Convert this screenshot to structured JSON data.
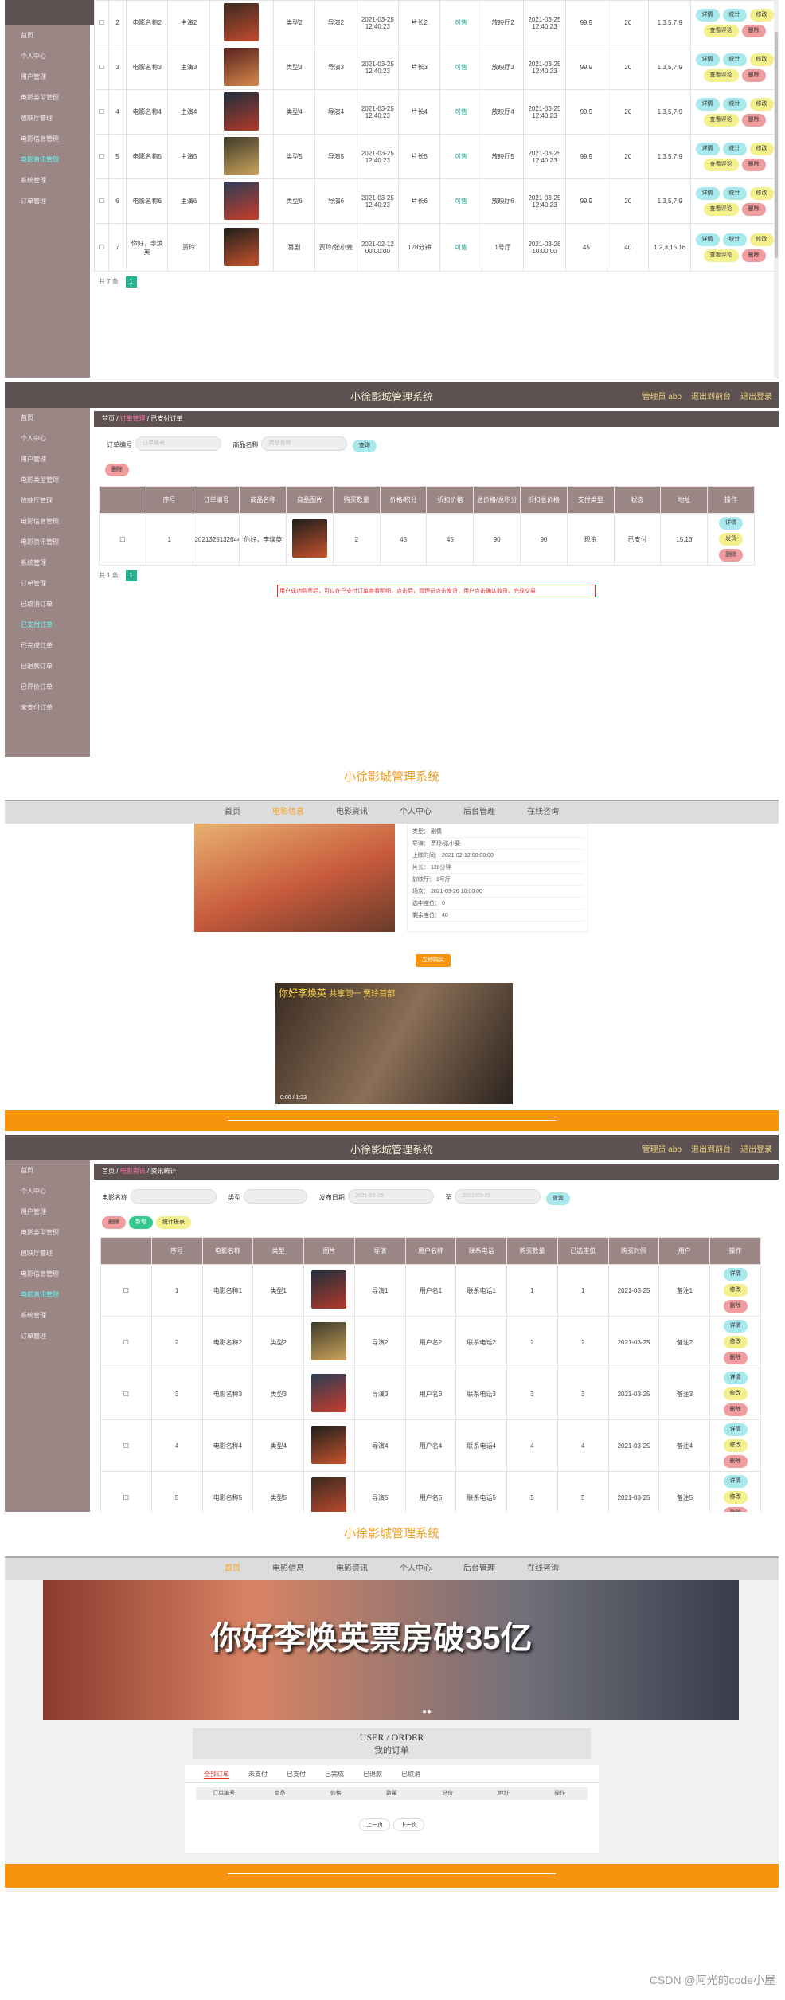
{
  "admin": {
    "title": "小徐影城管理系统",
    "links": [
      "管理员 abo",
      "退出到前台",
      "退出登录"
    ]
  },
  "shot1": {
    "rows": [
      {
        "idx": "2",
        "name": "电影名称2",
        "actor": "主演2",
        "type": "类型2",
        "dir": "导演2",
        "time": "2021-03-25 12:40:23",
        "len": "片长2",
        "stat": "可售",
        "hall": "放映厅2",
        "date": "2021-03-25 12:40:23",
        "price": "99.9",
        "seat": "20",
        "rows": "1,3,5,7,9"
      },
      {
        "idx": "3",
        "name": "电影名称3",
        "actor": "主演3",
        "type": "类型3",
        "dir": "导演3",
        "time": "2021-03-25 12:40:23",
        "len": "片长3",
        "stat": "可售",
        "hall": "放映厅3",
        "date": "2021-03-25 12:40:23",
        "price": "99.9",
        "seat": "20",
        "rows": "1,3,5,7,9"
      },
      {
        "idx": "4",
        "name": "电影名称4",
        "actor": "主演4",
        "type": "类型4",
        "dir": "导演4",
        "time": "2021-03-25 12:40:23",
        "len": "片长4",
        "stat": "可售",
        "hall": "放映厅4",
        "date": "2021-03-25 12:40:23",
        "price": "99.9",
        "seat": "20",
        "rows": "1,3,5,7,9"
      },
      {
        "idx": "5",
        "name": "电影名称5",
        "actor": "主演5",
        "type": "类型5",
        "dir": "导演5",
        "time": "2021-03-25 12:40:23",
        "len": "片长5",
        "stat": "可售",
        "hall": "放映厅5",
        "date": "2021-03-25 12:40:23",
        "price": "99.9",
        "seat": "20",
        "rows": "1,3,5,7,9"
      },
      {
        "idx": "6",
        "name": "电影名称6",
        "actor": "主演6",
        "type": "类型6",
        "dir": "导演6",
        "time": "2021-03-25 12:40:23",
        "len": "片长6",
        "stat": "可售",
        "hall": "放映厅6",
        "date": "2021-03-25 12:40:23",
        "price": "99.9",
        "seat": "20",
        "rows": "1,3,5,7,9"
      },
      {
        "idx": "7",
        "name": "你好，李焕英",
        "actor": "贾玲",
        "type": "喜剧",
        "dir": "贾玲/张小斐",
        "time": "2021-02-12 00:00:00",
        "len": "128分钟",
        "stat": "可售",
        "hall": "1号厅",
        "date": "2021-03-26 10:00:00",
        "price": "45",
        "seat": "40",
        "rows": "1,2,3,15,16"
      }
    ],
    "actions": [
      "详情",
      "统计",
      "修改",
      "查看评论",
      "删除"
    ],
    "pager": "共 7 条"
  },
  "shot2": {
    "sidebar": [
      "首页",
      "个人中心",
      "用户管理",
      "电影类型管理",
      "放映厅管理",
      "电影信息管理",
      "电影资讯管理",
      "系统管理",
      "订单管理",
      "已取消订单",
      "已支付订单",
      "已完成订单",
      "已退款订单",
      "已评价订单",
      "未支付订单"
    ],
    "crumb": [
      "首页",
      "订单管理",
      "已支付订单"
    ],
    "filters": {
      "l1": "订单编号",
      "p1": "订单编号",
      "l2": "商品名称",
      "p2": "商品名称",
      "search": "查询"
    },
    "delete": "删除",
    "headers": [
      "",
      "序号",
      "订单编号",
      "商品名称",
      "商品图片",
      "购买数量",
      "价格/积分",
      "折扣价格",
      "总价格/总积分",
      "折扣总价格",
      "支付类型",
      "状态",
      "地址",
      "操作"
    ],
    "row": {
      "idx": "1",
      "no": "20213251326446893",
      "good": "你好，李焕英",
      "qty": "2",
      "p": "45",
      "dp": "45",
      "tot": "90",
      "dtot": "90",
      "pay": "现金",
      "st": "已支付",
      "addr": "15,16"
    },
    "acts": [
      "详情",
      "发货",
      "删除"
    ],
    "pager": "共 1 条",
    "tip": "用户成功购票后，可以在已支付订单查看明细，点击后，管理员点击发货，用户点击确认收货，完成交易"
  },
  "shot3": {
    "title": "小徐影城管理系统",
    "nav": [
      "首页",
      "电影信息",
      "电影资讯",
      "个人中心",
      "后台管理",
      "在线咨询"
    ],
    "navOn": 1,
    "details": [
      [
        "类型",
        "剧情"
      ],
      [
        "导演",
        "贾玲/张小斐"
      ],
      [
        "上映时间",
        "2021-02-12 00:00:00"
      ],
      [
        "片长",
        "128分钟"
      ],
      [
        "放映厅",
        "1号厅"
      ],
      [
        "场次",
        "2021-03-26 10:00:00"
      ],
      [
        "选中座位",
        "0"
      ],
      [
        "剩余座位",
        "40"
      ]
    ],
    "buy": "立即购买",
    "video": {
      "t1": "你好李焕英",
      "t2": "共享同一 贾玲首部",
      "time": "0:00 / 1:23"
    }
  },
  "shot4": {
    "crumb": [
      "首页",
      "电影资讯",
      "资讯统计"
    ],
    "filters": [
      "电影名称",
      "类型",
      "发布日期",
      "2021-03-25",
      "至",
      "2021-03-29",
      "查询"
    ],
    "btns": [
      "删除",
      "新增",
      "统计报表"
    ],
    "headers": [
      "",
      "序号",
      "电影名称",
      "类型",
      "图片",
      "导演",
      "用户名称",
      "联系电话",
      "购买数量",
      "已选座位",
      "购买时间",
      "用户",
      "操作"
    ],
    "rows": [
      [
        "1",
        "电影名称1",
        "类型1",
        "导演1",
        "用户名1",
        "联系电话1",
        "1",
        "1",
        "2021-03-25",
        "备注1"
      ],
      [
        "2",
        "电影名称2",
        "类型2",
        "导演2",
        "用户名2",
        "联系电话2",
        "2",
        "2",
        "2021-03-25",
        "备注2"
      ],
      [
        "3",
        "电影名称3",
        "类型3",
        "导演3",
        "用户名3",
        "联系电话3",
        "3",
        "3",
        "2021-03-25",
        "备注3"
      ],
      [
        "4",
        "电影名称4",
        "类型4",
        "导演4",
        "用户名4",
        "联系电话4",
        "4",
        "4",
        "2021-03-25",
        "备注4"
      ],
      [
        "5",
        "电影名称5",
        "类型5",
        "导演5",
        "用户名5",
        "联系电话5",
        "5",
        "5",
        "2021-03-25",
        "备注5"
      ]
    ],
    "acts": [
      "详情",
      "修改",
      "删除"
    ]
  },
  "shot5": {
    "title": "小徐影城管理系统",
    "nav": [
      "首页",
      "电影信息",
      "电影资讯",
      "个人中心",
      "后台管理",
      "在线咨询"
    ],
    "banner": "你好李焕英票房破35亿",
    "h1": "USER / ORDER",
    "h2": "我的订单",
    "tabs": [
      "全部订单",
      "未支付",
      "已支付",
      "已完成",
      "已退款",
      "已取消"
    ],
    "cols": [
      "订单编号",
      "商品",
      "价格",
      "数量",
      "总价",
      "地址",
      "操作"
    ],
    "pager": [
      "上一页",
      "下一页"
    ]
  },
  "watermark": "CSDN @阿光的code小屋",
  "colors": {
    "brand": "#5e5152",
    "side": "#9a8684",
    "orange": "#f7930e",
    "accent": "#24b38e"
  }
}
